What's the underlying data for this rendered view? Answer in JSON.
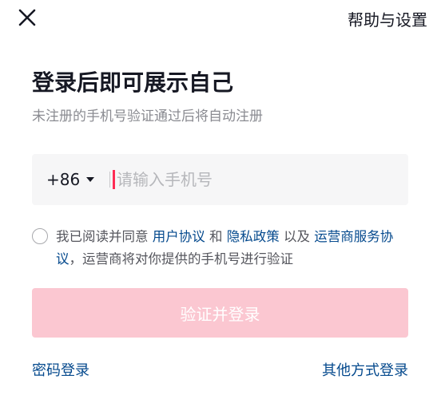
{
  "header": {
    "close_icon": "close-icon",
    "help_label": "帮助与设置"
  },
  "main": {
    "title": "登录后即可展示自己",
    "subtitle": "未注册的手机号验证通过后将自动注册",
    "phone": {
      "country_code": "+86",
      "placeholder": "请输入手机号",
      "value": ""
    },
    "agreement": {
      "prefix": "我已阅读并同意 ",
      "link_user_agreement": "用户协议",
      "and": " 和 ",
      "link_privacy_policy": "隐私政策",
      "and2": " 以及 ",
      "link_carrier_terms": "运营商服务协议",
      "suffix": "，运营商将对你提供的手机号进行验证"
    },
    "submit_label": "验证并登录"
  },
  "footer": {
    "password_login": "密码登录",
    "other_login": "其他方式登录"
  },
  "colors": {
    "accent": "#fe2c55",
    "button_disabled": "#fbc7d1",
    "link": "#04498d",
    "muted": "#8a8b91"
  }
}
